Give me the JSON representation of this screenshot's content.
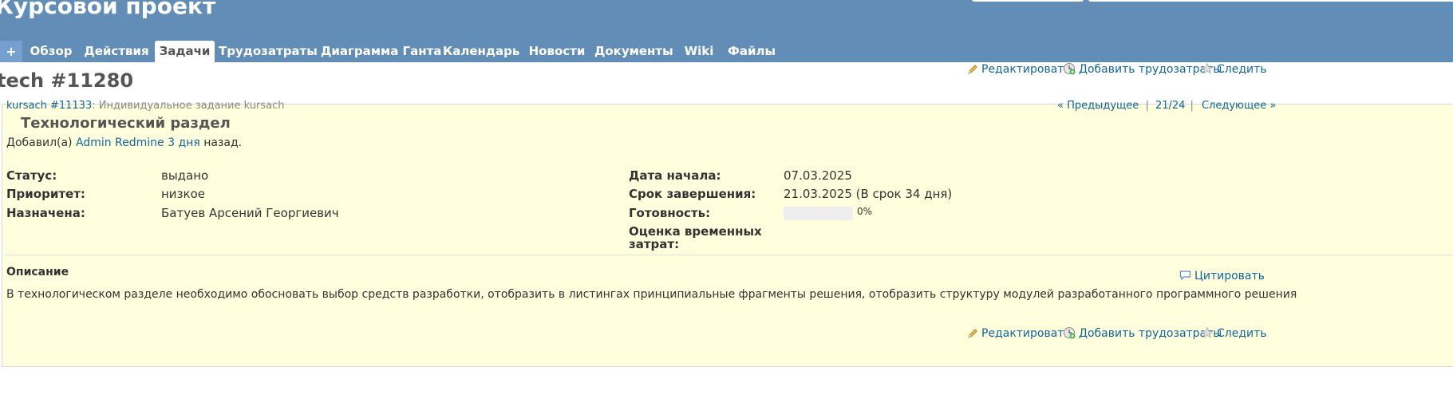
{
  "header": {
    "project_title": "Курсовой проект",
    "tabs": [
      {
        "label": "+"
      },
      {
        "label": "Обзор"
      },
      {
        "label": "Действия"
      },
      {
        "label": "Задачи",
        "selected": true
      },
      {
        "label": "Трудозатраты"
      },
      {
        "label": "Диаграмма Ганта"
      },
      {
        "label": "Календарь"
      },
      {
        "label": "Новости"
      },
      {
        "label": "Документы"
      },
      {
        "label": "Wiki"
      },
      {
        "label": "Файлы"
      }
    ]
  },
  "issue": {
    "title": "tech #11280",
    "parent_link": "kursach #11133",
    "parent_subject": ": Индивидуальное задание kursach",
    "subject": "Технологический раздел",
    "author_prefix": "Добавил(а)",
    "author": "Admin Redmine",
    "age": "3 дня",
    "age_suffix": "назад.",
    "nav": {
      "prev": "« Предыдущее",
      "sep1": "|",
      "position": "21/24",
      "sep2": "|",
      "next": "Следующее »"
    },
    "attributes_left": [
      {
        "label": "Статус:",
        "value": "выдано"
      },
      {
        "label": "Приоритет:",
        "value": "низкое"
      },
      {
        "label": "Назначена:",
        "value": "Батуев Арсений Георгиевич"
      }
    ],
    "attributes_right": [
      {
        "label": "Дата начала:",
        "value": "07.03.2025"
      },
      {
        "label": "Срок завершения:",
        "value": "21.03.2025 (В срок 34 дня)"
      },
      {
        "label": "Готовность:",
        "value": "0%"
      },
      {
        "label_line1": "Оценка временных",
        "label_line2": "затрат:",
        "value": ""
      }
    ],
    "done_ratio": 0,
    "description_heading": "Описание",
    "quote_label": "Цитировать",
    "description_text": "В технологическом разделе необходимо обосновать выбор средств разработки, отобразить в листингах принципиальные фрагменты решения, отобразить структуру модулей разработанного программного решения"
  },
  "actions": {
    "edit": "Редактировать",
    "log_time": "Добавить трудозатраты",
    "watch": "Следить"
  },
  "icons": {
    "edit": "pencil-icon",
    "log_time": "clock-add-icon",
    "watch": "star-icon",
    "quote": "speech-bubble-icon"
  },
  "colors": {
    "header_bg": "#628db6",
    "tab_plus_bg": "#759fcf",
    "link": "#116699",
    "issue_bg": "#ffffdd",
    "issue_border": "#d7d7d7"
  }
}
